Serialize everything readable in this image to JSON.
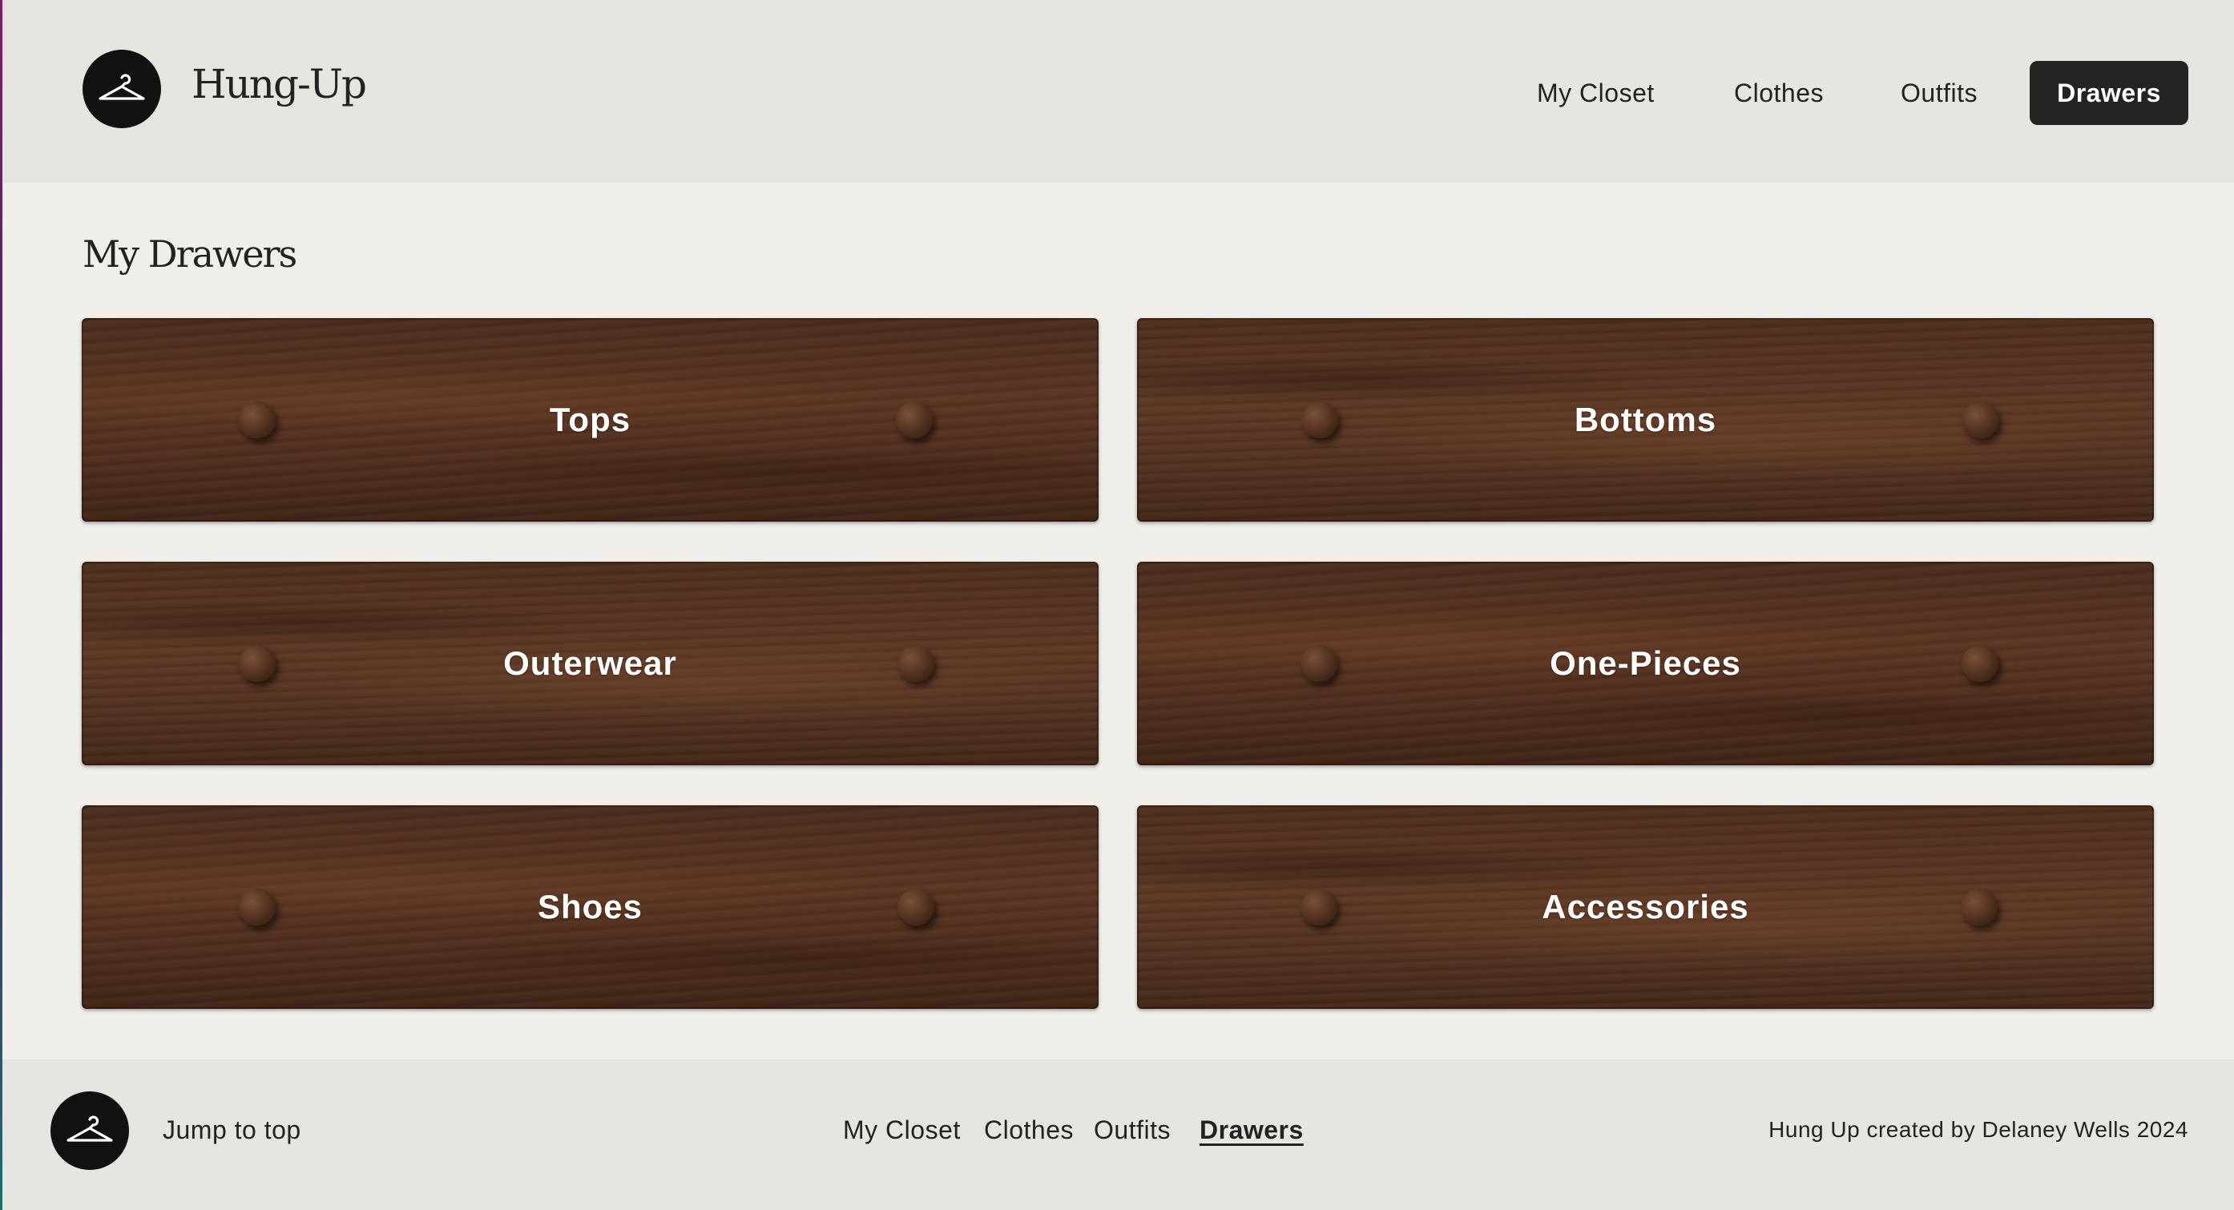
{
  "header": {
    "brand": "Hung-Up",
    "logo_icon": "hanger-icon",
    "nav": {
      "my_closet": "My Closet",
      "clothes": "Clothes",
      "outfits": "Outfits",
      "drawers": "Drawers"
    },
    "active_nav": "Drawers"
  },
  "main": {
    "title": "My Drawers",
    "drawers": [
      {
        "label": "Tops"
      },
      {
        "label": "Bottoms"
      },
      {
        "label": "Outerwear"
      },
      {
        "label": "One-Pieces"
      },
      {
        "label": "Shoes"
      },
      {
        "label": "Accessories"
      }
    ]
  },
  "footer": {
    "logo_icon": "hanger-icon",
    "jump": "Jump to top",
    "nav": {
      "my_closet": "My Closet",
      "clothes": "Clothes",
      "outfits": "Outfits",
      "drawers": "Drawers"
    },
    "active_nav": "Drawers",
    "credit": "Hung Up created by Delaney Wells 2024"
  },
  "colors": {
    "background": "#f0efea",
    "header_bg": "#e7e5df",
    "active_button": "#232323",
    "text": "#222222",
    "wood": "#54311f"
  }
}
